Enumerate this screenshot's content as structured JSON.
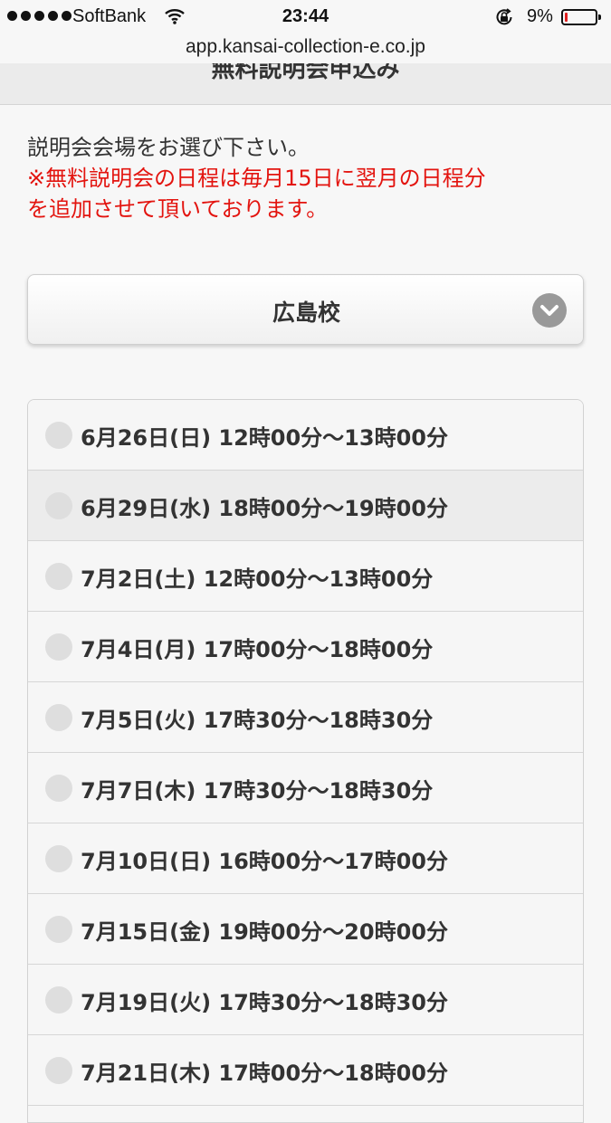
{
  "status_bar": {
    "carrier": "SoftBank",
    "time": "23:44",
    "battery": "9%",
    "battery_level": 0.09,
    "battery_color": "#e02020"
  },
  "browser": {
    "url": "app.kansai-collection-e.co.jp"
  },
  "header": {
    "title": "無料説明会申込み"
  },
  "intro": {
    "prompt": "説明会会場をお選び下さい。",
    "notice_line1": "※無料説明会の日程は毎月15日に翌月の日程分",
    "notice_line2": "を追加させて頂いております。",
    "notice_color": "#e3140f"
  },
  "venue_select": {
    "selected": "広島校",
    "icon": "chevron-down-icon"
  },
  "schedule": [
    {
      "label": "6月26日(日) 12時00分〜13時00分"
    },
    {
      "label": "6月29日(水) 18時00分〜19時00分"
    },
    {
      "label": "7月2日(土) 12時00分〜13時00分"
    },
    {
      "label": "7月4日(月) 17時00分〜18時00分"
    },
    {
      "label": "7月5日(火) 17時30分〜18時30分"
    },
    {
      "label": "7月7日(木) 17時30分〜18時30分"
    },
    {
      "label": "7月10日(日) 16時00分〜17時00分"
    },
    {
      "label": "7月15日(金) 19時00分〜20時00分"
    },
    {
      "label": "7月19日(火) 17時30分〜18時30分"
    },
    {
      "label": "7月21日(木) 17時00分〜18時00分"
    }
  ]
}
